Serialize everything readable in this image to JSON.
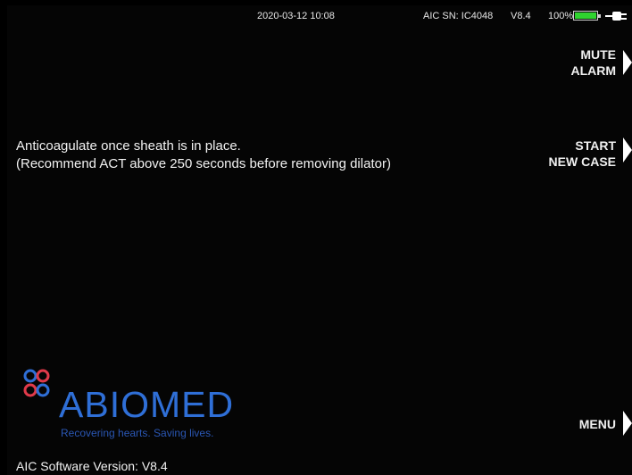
{
  "status": {
    "datetime": "2020-03-12  10:08",
    "serial": "AIC SN: IC4048",
    "version": "V8.4",
    "battery_percent_text": "100%",
    "battery_level": 1.0,
    "battery_color": "#2fd32f",
    "plug_icon": "power-plug-icon"
  },
  "message": {
    "line1": "Anticoagulate once sheath is in place.",
    "line2": "(Recommend ACT above 250 seconds before removing dilator)"
  },
  "softkeys": {
    "mute_line1": "MUTE",
    "mute_line2": "ALARM",
    "start_line1": "START",
    "start_line2": "NEW CASE",
    "menu": "MENU"
  },
  "logo": {
    "wordmark": "ABIOMED",
    "tagline": "Recovering hearts. Saving lives.",
    "mark_icon": "abiomed-logo-icon",
    "brand_color": "#2f6fd7",
    "accent_color": "#e03a4a"
  },
  "footer": {
    "software_version": "AIC Software Version: V8.4"
  }
}
